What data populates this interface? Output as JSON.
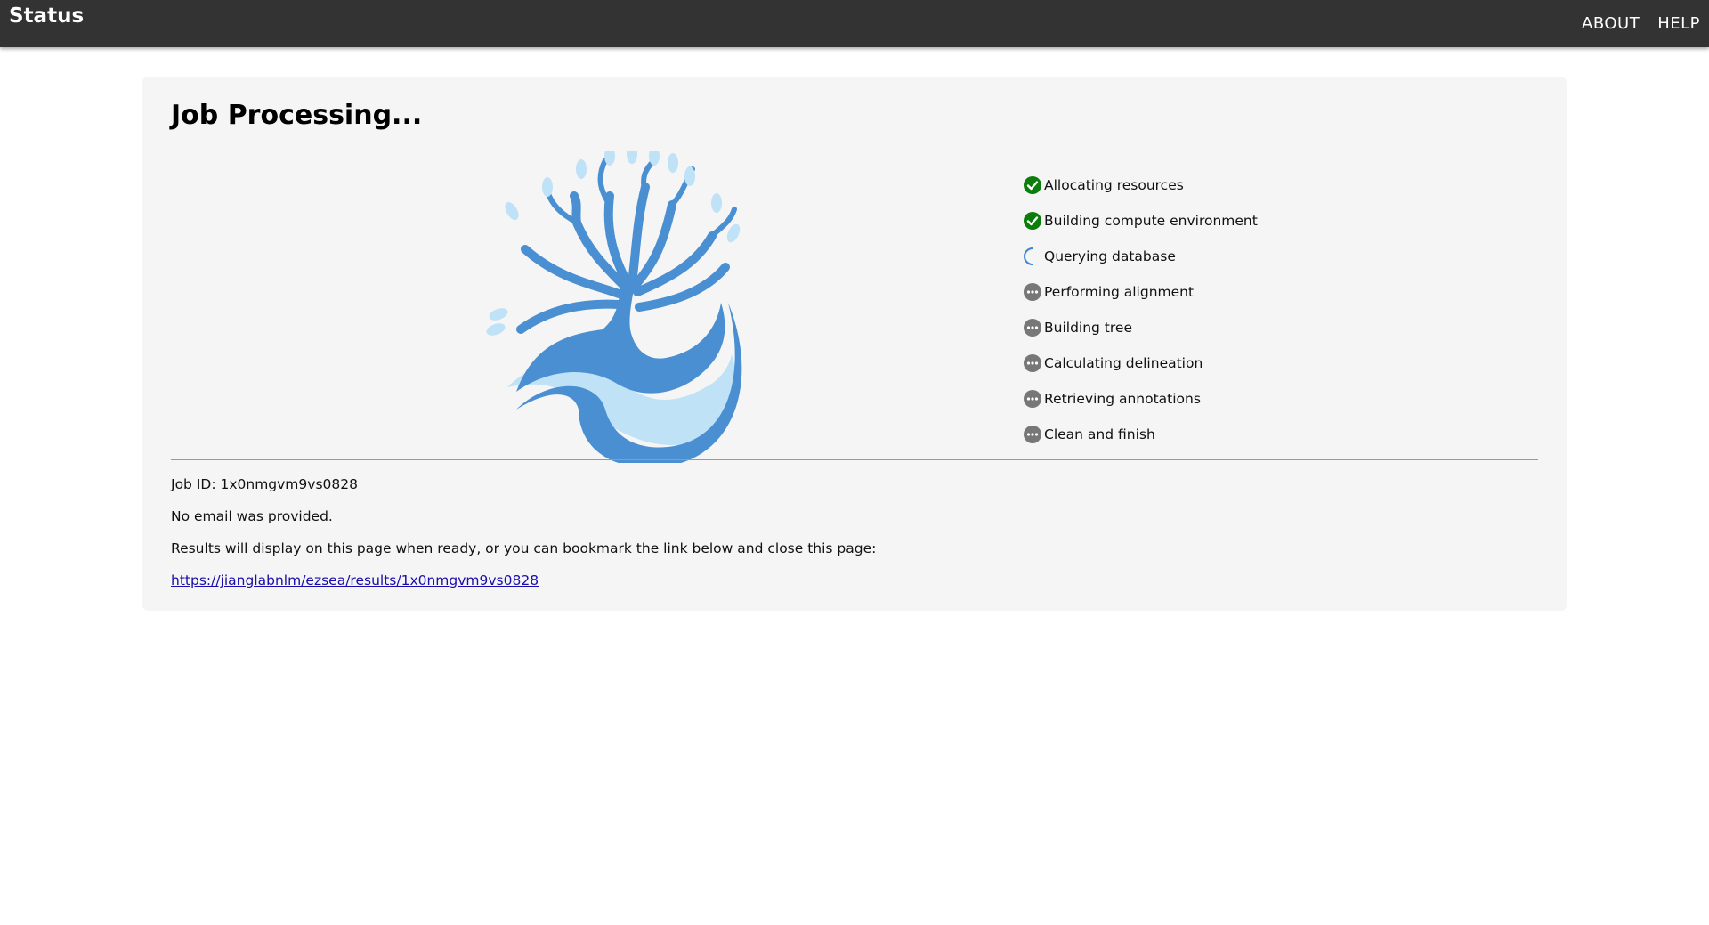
{
  "header": {
    "title": "Status",
    "nav": [
      {
        "label": "ABOUT"
      },
      {
        "label": "HELP"
      }
    ]
  },
  "job": {
    "heading": "Job Processing...",
    "steps": [
      {
        "label": "Allocating resources",
        "status": "done",
        "icon": "check-circle-icon"
      },
      {
        "label": "Building compute environment",
        "status": "done",
        "icon": "check-circle-icon"
      },
      {
        "label": "Querying database",
        "status": "in-progress",
        "icon": "spinner-icon"
      },
      {
        "label": "Performing alignment",
        "status": "pending",
        "icon": "ellipsis-circle-icon"
      },
      {
        "label": "Building tree",
        "status": "pending",
        "icon": "ellipsis-circle-icon"
      },
      {
        "label": "Calculating delineation",
        "status": "pending",
        "icon": "ellipsis-circle-icon"
      },
      {
        "label": "Retrieving annotations",
        "status": "pending",
        "icon": "ellipsis-circle-icon"
      },
      {
        "label": "Clean and finish",
        "status": "pending",
        "icon": "ellipsis-circle-icon"
      }
    ],
    "job_id_text": "Job ID: 1x0nmgvm9vs0828",
    "email_text": "No email was provided.",
    "results_text": "Results will display on this page when ready, or you can bookmark the link below and close this page:",
    "results_link": "https://jianglabnlm/ezsea/results/1x0nmgvm9vs0828"
  },
  "colors": {
    "header_bg": "#333333",
    "card_bg": "#f5f5f5",
    "done": "#0a7d0a",
    "in_progress": "#3a86d4",
    "pending": "#777777",
    "logo_dark": "#4a8fd2",
    "logo_light": "#bfe2f7",
    "link": "#1a0dab"
  }
}
